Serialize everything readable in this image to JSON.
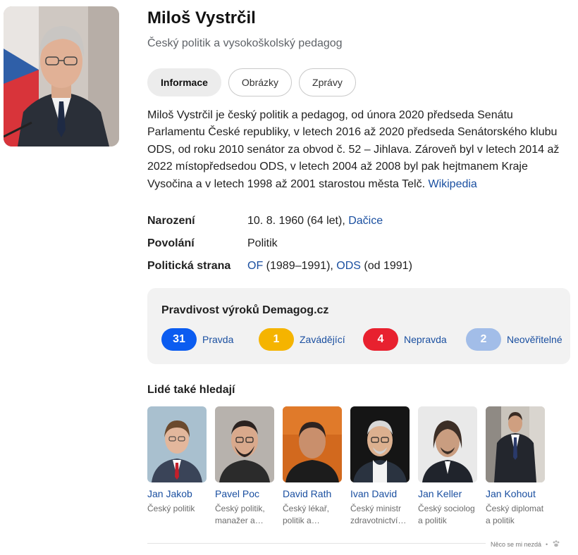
{
  "entity": {
    "name": "Miloš Vystrčil",
    "subtitle": "Český politik a vysokoškolský pedagog"
  },
  "tabs": [
    {
      "label": "Informace",
      "active": true
    },
    {
      "label": "Obrázky",
      "active": false
    },
    {
      "label": "Zprávy",
      "active": false
    }
  ],
  "description": {
    "text": "Miloš Vystrčil je český politik a pedagog, od února 2020 předseda Senátu Parlamentu České republiky, v letech 2016 až 2020 předseda Senátorského klubu ODS, od roku 2010 senátor za obvod č. 52 – Jihlava. Zároveň byl v letech 2014 až 2022 místopředsedou ODS, v letech 2004 až 2008 byl pak hejtmanem Kraje Vysočina a v letech 1998 až 2001 starostou města Telč.",
    "source_link": "Wikipedia"
  },
  "facts": {
    "birth": {
      "label": "Narození",
      "text": "10. 8. 1960 (64 let), ",
      "link": "Dačice"
    },
    "occupation": {
      "label": "Povolání",
      "text": "Politik"
    },
    "party": {
      "label": "Politická strana",
      "link1": "OF",
      "text1": " (1989–1991), ",
      "link2": "ODS",
      "text2": " (od 1991)"
    }
  },
  "demagog": {
    "title": "Pravdivost výroků Demagog.cz",
    "verdicts": [
      {
        "count": "31",
        "label": "Pravda",
        "color": "#0b5cf0"
      },
      {
        "count": "1",
        "label": "Zavádějící",
        "color": "#f5b400"
      },
      {
        "count": "4",
        "label": "Nepravda",
        "color": "#e8212f"
      },
      {
        "count": "2",
        "label": "Neověřitelné",
        "color": "#a2bde8"
      }
    ]
  },
  "related": {
    "title": "Lidé také hledají",
    "people": [
      {
        "name": "Jan Jakob",
        "desc": "Český politik"
      },
      {
        "name": "Pavel Poc",
        "desc": "Český politik, manažer a…"
      },
      {
        "name": "David Rath",
        "desc": "Český lékař, politik a…"
      },
      {
        "name": "Ivan David",
        "desc": "Český ministr zdravotnictví…"
      },
      {
        "name": "Jan Keller",
        "desc": "Český sociolog a politik"
      },
      {
        "name": "Jan Kohout",
        "desc": "Český diplomat a politik"
      }
    ]
  },
  "feedback": {
    "text": "Něco se mi nezdá",
    "separator": "•"
  },
  "icons": {
    "feedback": "paw-icon"
  }
}
